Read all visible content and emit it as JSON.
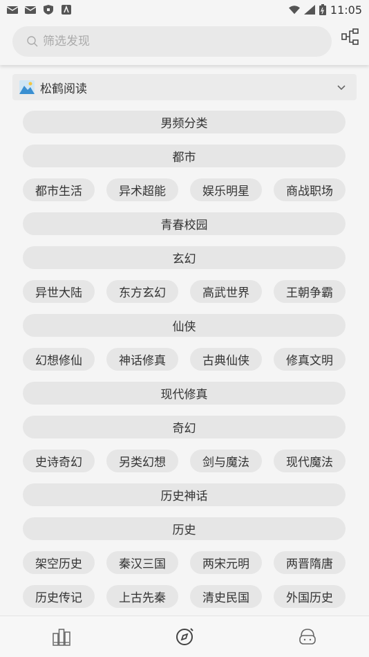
{
  "status_bar": {
    "time": "11:05",
    "icons": [
      "mail-icon",
      "mail-icon",
      "shield-icon",
      "text-icon",
      "wifi-icon",
      "signal-icon",
      "battery-icon"
    ]
  },
  "search": {
    "placeholder": "筛选发现"
  },
  "source": {
    "name": "松鹤阅读"
  },
  "tag_rows": [
    [
      "男频分类"
    ],
    [
      "都市"
    ],
    [
      "都市生活",
      "异术超能",
      "娱乐明星",
      "商战职场"
    ],
    [
      "青春校园"
    ],
    [
      "玄幻"
    ],
    [
      "异世大陆",
      "东方玄幻",
      "高武世界",
      "王朝争霸"
    ],
    [
      "仙侠"
    ],
    [
      "幻想修仙",
      "神话修真",
      "古典仙侠",
      "修真文明"
    ],
    [
      "现代修真"
    ],
    [
      "奇幻"
    ],
    [
      "史诗奇幻",
      "另类幻想",
      "剑与魔法",
      "现代魔法"
    ],
    [
      "历史神话"
    ],
    [
      "历史"
    ],
    [
      "架空历史",
      "秦汉三国",
      "两宋元明",
      "两晋隋唐"
    ],
    [
      "历史传记",
      "上古先秦",
      "清史民国",
      "外国历史"
    ]
  ],
  "bottom_nav": {
    "items": [
      {
        "icon": "bookshelf-icon"
      },
      {
        "icon": "discover-icon"
      },
      {
        "icon": "profile-icon"
      }
    ]
  },
  "colors": {
    "background": "#f5f5f5",
    "pill": "#e6e6e6",
    "text": "#333333"
  }
}
